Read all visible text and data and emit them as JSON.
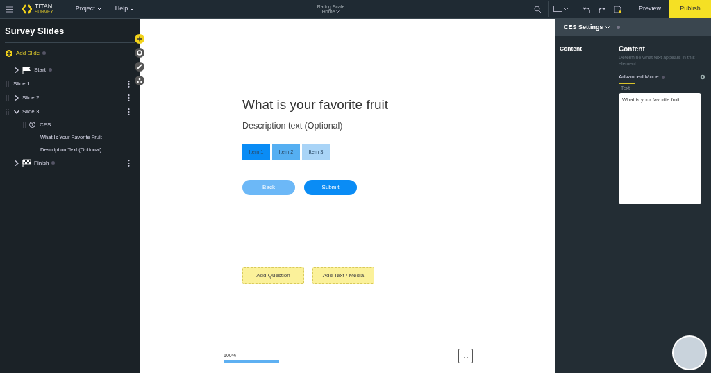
{
  "topbar": {
    "logo_title": "TITAN",
    "logo_subtitle": "SURVEY",
    "menus": [
      {
        "label": "Project"
      },
      {
        "label": "Help"
      }
    ],
    "survey_name": "Rating Scale",
    "page": "Home",
    "preview": "Preview",
    "publish": "Publish"
  },
  "sidebar": {
    "title": "Survey Slides",
    "add_slide": "Add Slide",
    "items": [
      {
        "kind": "start",
        "label": "Start",
        "expanded": false,
        "info": true,
        "menu": false
      },
      {
        "kind": "slide",
        "label": "Slide 1",
        "expanded": false,
        "info": false,
        "menu": true
      },
      {
        "kind": "slide",
        "label": "Slide 2",
        "expanded": false,
        "info": false,
        "menu": true
      },
      {
        "kind": "slide",
        "label": "Slide 3",
        "expanded": true,
        "info": false,
        "menu": true,
        "children": [
          {
            "label": "CES",
            "children": [
              {
                "label": "What Is Your Favorite Fruit"
              },
              {
                "label": "Description Text (Optional)"
              }
            ]
          }
        ]
      },
      {
        "kind": "finish",
        "label": "Finish",
        "expanded": false,
        "info": true,
        "menu": true
      }
    ]
  },
  "canvas": {
    "question": "What is your favorite fruit",
    "description": "Description text (Optional)",
    "items": [
      {
        "label": "Item 1",
        "color": "#0a8cf5"
      },
      {
        "label": "Item 2",
        "color": "#55aff2"
      },
      {
        "label": "Item 3",
        "color": "#a9d4f7"
      }
    ],
    "back": "Back",
    "submit": "Submit",
    "add_buttons": [
      "Add Question",
      "Add Text / Media"
    ],
    "progress": {
      "reading": "100%",
      "level": 1
    }
  },
  "settings": {
    "title": "CES Settings",
    "nav": [
      {
        "label": "Content"
      }
    ],
    "heading": "Content",
    "hint": "Determine what text appears in this element.",
    "advanced_mode": "Advanced Mode",
    "text_label": "Text",
    "text_value": "What is your favorite fruit"
  }
}
